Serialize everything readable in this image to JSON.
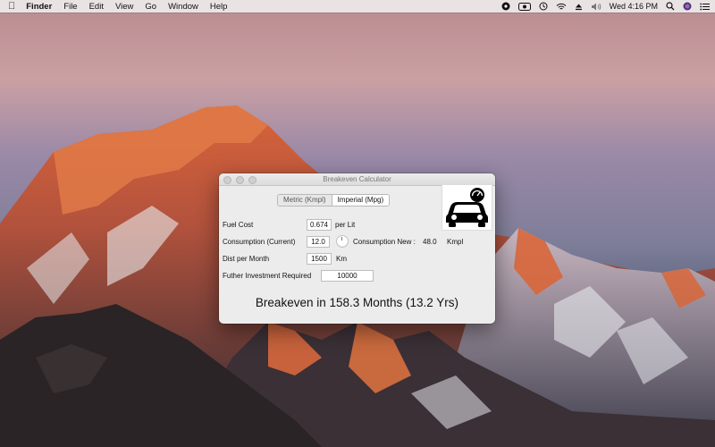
{
  "menubar": {
    "app": "Finder",
    "items": [
      "File",
      "Edit",
      "View",
      "Go",
      "Window",
      "Help"
    ],
    "clock": "Wed 4:16 PM"
  },
  "window": {
    "title": "Breakeven Calculator",
    "segments": [
      "Metric (Kmpl)",
      "Imperial (Mpg)"
    ],
    "selected_segment": "Imperial (Mpg)",
    "fuel_cost_label": "Fuel Cost",
    "fuel_cost_value": "0.674",
    "fuel_cost_unit": "per Lit",
    "consumption_label": "Consumption (Current)",
    "consumption_value": "12.0",
    "consumption_new_label": "Consumption New :",
    "consumption_new_value": "48.0",
    "consumption_new_unit": "Kmpl",
    "dist_label": "Dist per Month",
    "dist_value": "1500",
    "dist_unit": "Km",
    "investment_label": "Futher Investment Required",
    "investment_value": "10000",
    "result": "Breakeven in 158.3 Months (13.2 Yrs)"
  },
  "icons": {
    "apple": "apple-icon",
    "car": "car-speedometer-icon"
  }
}
